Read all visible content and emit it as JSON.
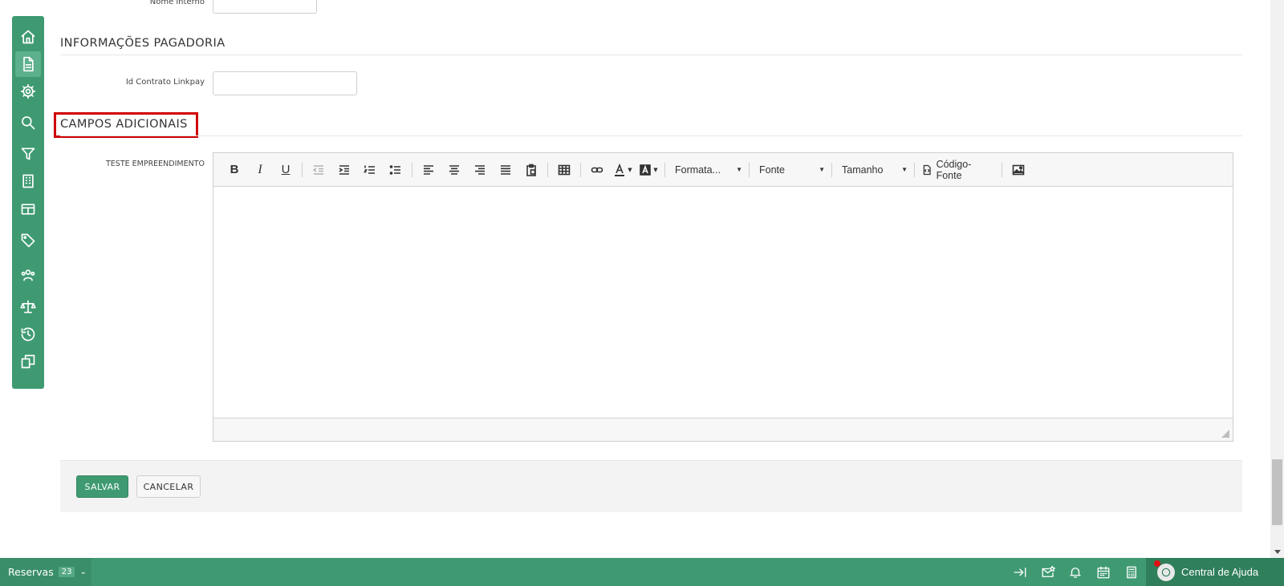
{
  "form": {
    "nome_interno_label": "Nome interno",
    "section_pagadoria": "INFORMAÇÕES PAGADORIA",
    "id_contrato_label": "Id Contrato Linkpay",
    "section_campos": "CAMPOS ADICIONAIS",
    "teste_label": "TESTE EMPREENDIMENTO"
  },
  "editor": {
    "toolbar": {
      "bold": "B",
      "italic": "I",
      "underline": "U",
      "format_label": "Formata...",
      "font_label": "Fonte",
      "size_label": "Tamanho",
      "source_label": "Código-Fonte"
    }
  },
  "actions": {
    "save_label": "SALVAR",
    "cancel_label": "CANCELAR"
  },
  "bottombar": {
    "reservas_label": "Reservas",
    "reservas_count": "23",
    "help_label": "Central de Ajuda"
  },
  "sidebar": {
    "items": [
      "home-icon",
      "document-icon",
      "settings-icon",
      "search-icon",
      "filter-icon",
      "building-icon",
      "table-icon",
      "tag-icon",
      "users-icon",
      "scale-icon",
      "history-icon",
      "copy-icon"
    ]
  },
  "colors": {
    "primary": "#3f9a72",
    "highlight": "#d00000"
  }
}
